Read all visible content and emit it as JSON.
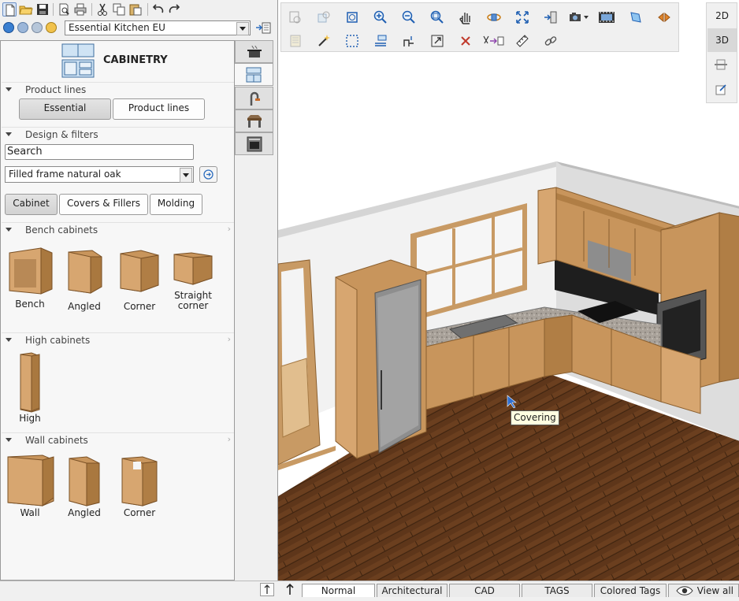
{
  "catalog": {
    "selected": "Essential Kitchen EU"
  },
  "panel": {
    "title": "CABINETRY",
    "product_lines": {
      "label": "Product lines",
      "buttons": [
        "Essential",
        "Product lines"
      ]
    },
    "design_filters": {
      "label": "Design & filters",
      "search_value": "Search",
      "finish": "Filled frame natural oak",
      "tabs": [
        "Cabinet",
        "Covers & Fillers",
        "Molding"
      ]
    },
    "bench_cabinets": {
      "label": "Bench cabinets",
      "items": [
        "Bench",
        "Angled",
        "Corner",
        "Straight corner"
      ]
    },
    "high_cabinets": {
      "label": "High cabinets",
      "items": [
        "High"
      ]
    },
    "wall_cabinets": {
      "label": "Wall cabinets",
      "items": [
        "Wall",
        "Angled",
        "Corner"
      ]
    }
  },
  "view": {
    "btn_2d": "2D",
    "btn_3d": "3D",
    "tooltip": "Covering"
  },
  "status": {
    "tabs": [
      "Normal",
      "Architectural",
      "CAD",
      "TAGS",
      "Colored Tags",
      "View all"
    ]
  },
  "colors": {
    "wood": "#c8955c",
    "floor": "#5e361a",
    "accent": "#1f77c7"
  }
}
